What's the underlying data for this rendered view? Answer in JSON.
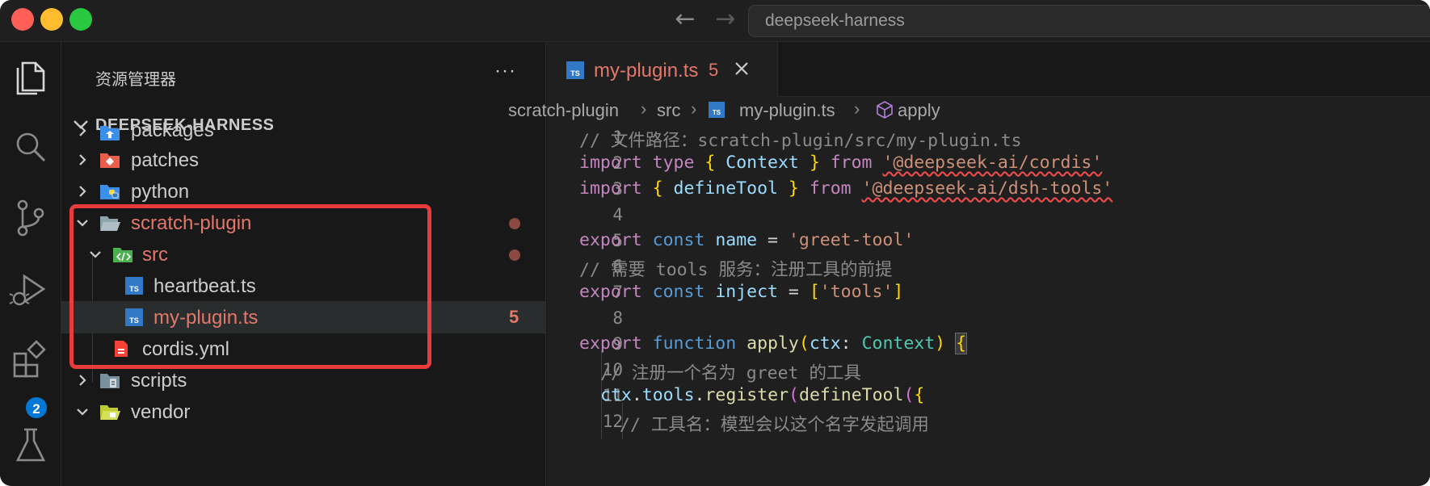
{
  "titlebar": {
    "search_text": "deepseek-harness"
  },
  "activity_bar": {
    "extensions_badge": "2"
  },
  "sidebar": {
    "title": "资源管理器",
    "more": "···",
    "root": "DEEPSEEK-HARNESS",
    "items": [
      {
        "label": "packages"
      },
      {
        "label": "patches"
      },
      {
        "label": "python"
      },
      {
        "label": "scratch-plugin"
      },
      {
        "label": "src"
      },
      {
        "label": "heartbeat.ts"
      },
      {
        "label": "my-plugin.ts",
        "count": "5"
      },
      {
        "label": "cordis.yml"
      },
      {
        "label": "scripts"
      },
      {
        "label": "vendor"
      }
    ]
  },
  "editor": {
    "tab": {
      "label": "my-plugin.ts",
      "count": "5"
    },
    "breadcrumb": [
      "scratch-plugin",
      "src",
      "my-plugin.ts",
      "apply"
    ],
    "line_numbers": [
      "1",
      "2",
      "3",
      "4",
      "5",
      "6",
      "7",
      "8",
      "9",
      "10",
      "11",
      "12"
    ],
    "code": {
      "l1_comment": "// 文件路径：scratch-plugin/src/my-plugin.ts",
      "l2_kw1": "import",
      "l2_kw2": "type",
      "l2_open": "{",
      "l2_id": " Context ",
      "l2_close": "}",
      "l2_from": "from",
      "l2_str": "'@deepseek-ai/cordis'",
      "l3_kw1": "import",
      "l3_open": "{",
      "l3_id": " defineTool ",
      "l3_close": "}",
      "l3_from": "from",
      "l3_str": "'@deepseek-ai/dsh-tools'",
      "l5_kw1": "export",
      "l5_kw2": "const",
      "l5_var": "name",
      "l5_eq": " = ",
      "l5_str": "'greet-tool'",
      "l6_comment": "// 需要 tools 服务：注册工具的前提",
      "l7_kw1": "export",
      "l7_kw2": "const",
      "l7_var": "inject",
      "l7_eq": " = ",
      "l7_open": "[",
      "l7_str": "'tools'",
      "l7_close": "]",
      "l9_kw1": "export",
      "l9_kw2": "function",
      "l9_fn": "apply",
      "l9_open": "(",
      "l9_param": "ctx",
      "l9_colon": ": ",
      "l9_type": "Context",
      "l9_close": ")",
      "l9_brace": "{",
      "l10_comment": "// 注册一个名为 greet 的工具",
      "l11_ctx": "ctx",
      "l11_dot1": ".",
      "l11_tools": "tools",
      "l11_dot2": ".",
      "l11_reg": "register",
      "l11_open": "(",
      "l11_def": "defineTool",
      "l11_open2": "(",
      "l11_brace": "{",
      "l12_comment": "// 工具名：模型会以这个名字发起调用"
    }
  },
  "colors": {
    "highlight_box": "#e83b3b",
    "modified_orange": "#e4776a",
    "typescript_blue": "#3178c6"
  }
}
